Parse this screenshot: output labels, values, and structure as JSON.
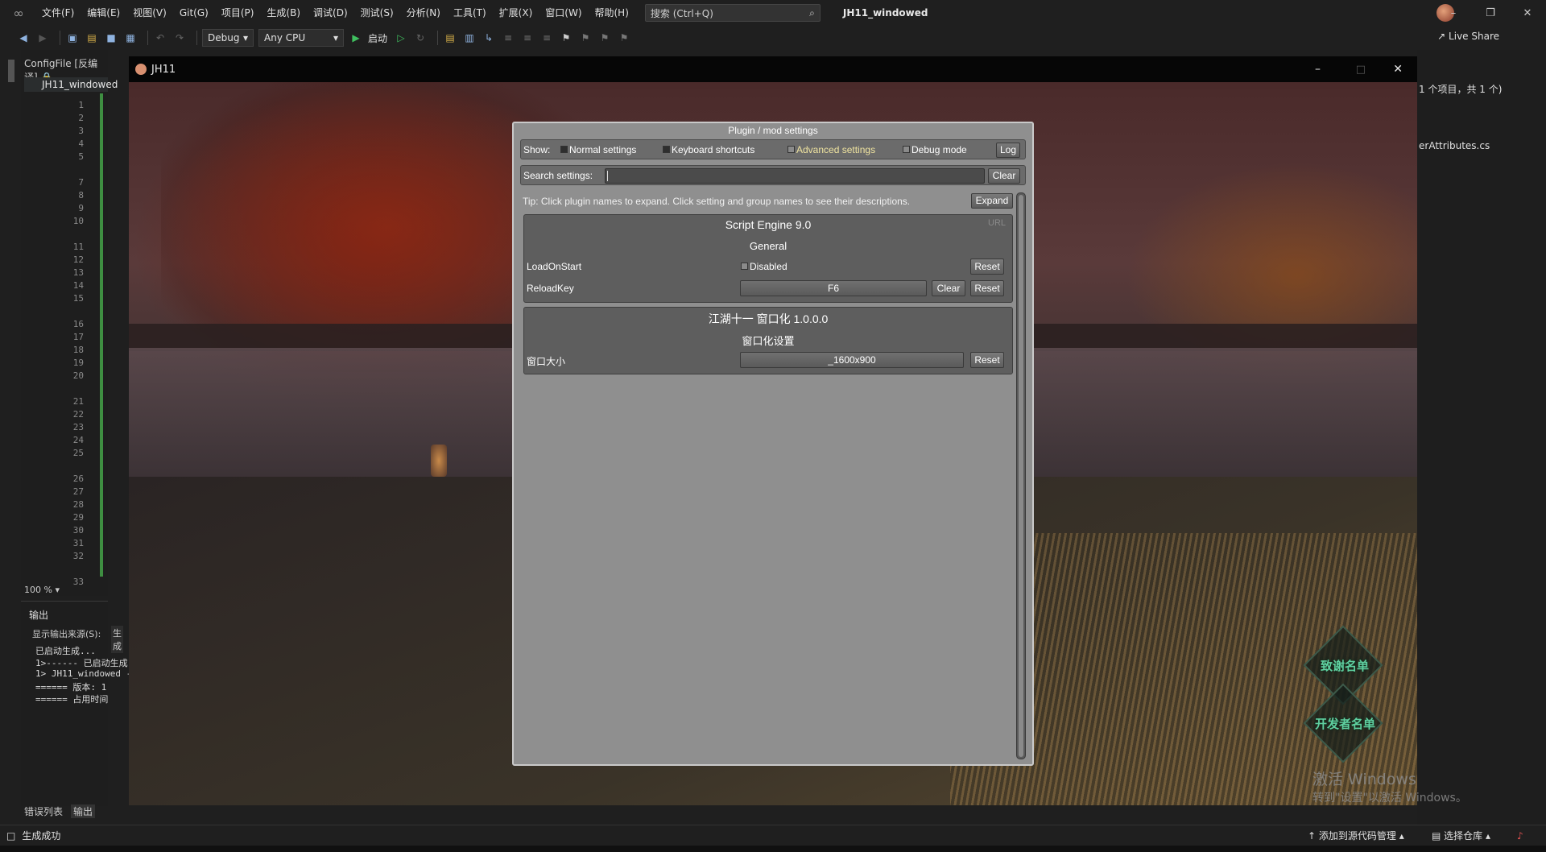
{
  "vs": {
    "menu": [
      "文件(F)",
      "编辑(E)",
      "视图(V)",
      "Git(G)",
      "项目(P)",
      "生成(B)",
      "调试(D)",
      "测试(S)",
      "分析(N)",
      "工具(T)",
      "扩展(X)",
      "窗口(W)",
      "帮助(H)"
    ],
    "search_placeholder": "搜索 (Ctrl+Q)",
    "solution_title": "JH11_windowed",
    "config": "Debug",
    "platform": "Any CPU",
    "start_label": "启动",
    "live_share": "Live Share",
    "doc_tab_configfile": "ConfigFile [反编译]",
    "doc_tab_project": "JH11_windowed",
    "line_numbers": [
      "1",
      "2",
      "3",
      "4",
      "5",
      "7",
      "8",
      "9",
      "10",
      "11",
      "12",
      "13",
      "14",
      "15",
      "16",
      "17",
      "18",
      "19",
      "20",
      "21",
      "22",
      "23",
      "24",
      "25",
      "26",
      "27",
      "28",
      "29",
      "30",
      "31",
      "32",
      "33"
    ],
    "zoom": "100 %",
    "output": {
      "title": "输出",
      "source_label": "显示输出来源(S):",
      "source_value": "生成",
      "lines": [
        "已启动生成...",
        "1>------ 已启动生成",
        "1>  JH11_windowed -",
        "====== 版本: 1",
        "====== 占用时间"
      ]
    },
    "bottom_tabs": [
      "错误列表",
      "输出"
    ],
    "status": "生成成功",
    "status_right": [
      "添加到源代码管理",
      "选择仓库"
    ],
    "right_panel": {
      "items_count": "1 个项目，共 1 个)",
      "file": "erAttributes.cs"
    }
  },
  "game": {
    "window_title": "JH11",
    "buttons": [
      "致谢名单",
      "开发者名单"
    ],
    "watermark_1": "激活 Windows",
    "watermark_2": "转到\"设置\"以激活 Windows。"
  },
  "config_manager": {
    "title": "Plugin / mod settings",
    "show_label": "Show:",
    "filters": [
      {
        "label": "Normal settings",
        "checked": true
      },
      {
        "label": "Keyboard shortcuts",
        "checked": true
      },
      {
        "label": "Advanced settings",
        "checked": false
      },
      {
        "label": "Debug mode",
        "checked": false
      }
    ],
    "log_button": "Log",
    "search_label": "Search settings:",
    "search_value": "",
    "clear_button": "Clear",
    "tip": "Tip: Click plugin names to expand. Click setting and group names to see their descriptions.",
    "expand_button": "Expand",
    "plugins": [
      {
        "name": "Script Engine 9.0",
        "url_label": "URL",
        "group": "General",
        "settings": [
          {
            "name": "LoadOnStart",
            "value": "Disabled",
            "type": "toggle",
            "reset": "Reset"
          },
          {
            "name": "ReloadKey",
            "value": "F6",
            "type": "key",
            "clear": "Clear",
            "reset": "Reset"
          }
        ]
      },
      {
        "name": "江湖十一 窗口化 1.0.0.0",
        "group": "窗口化设置",
        "settings": [
          {
            "name": "窗口大小",
            "value": "_1600x900",
            "type": "dropdown",
            "reset": "Reset"
          }
        ]
      }
    ]
  },
  "colors": {
    "advanced_settings_highlight": "#f0e4a0",
    "vs_accent": "#8fb3e0",
    "game_menu_green": "#5fd0a0"
  }
}
